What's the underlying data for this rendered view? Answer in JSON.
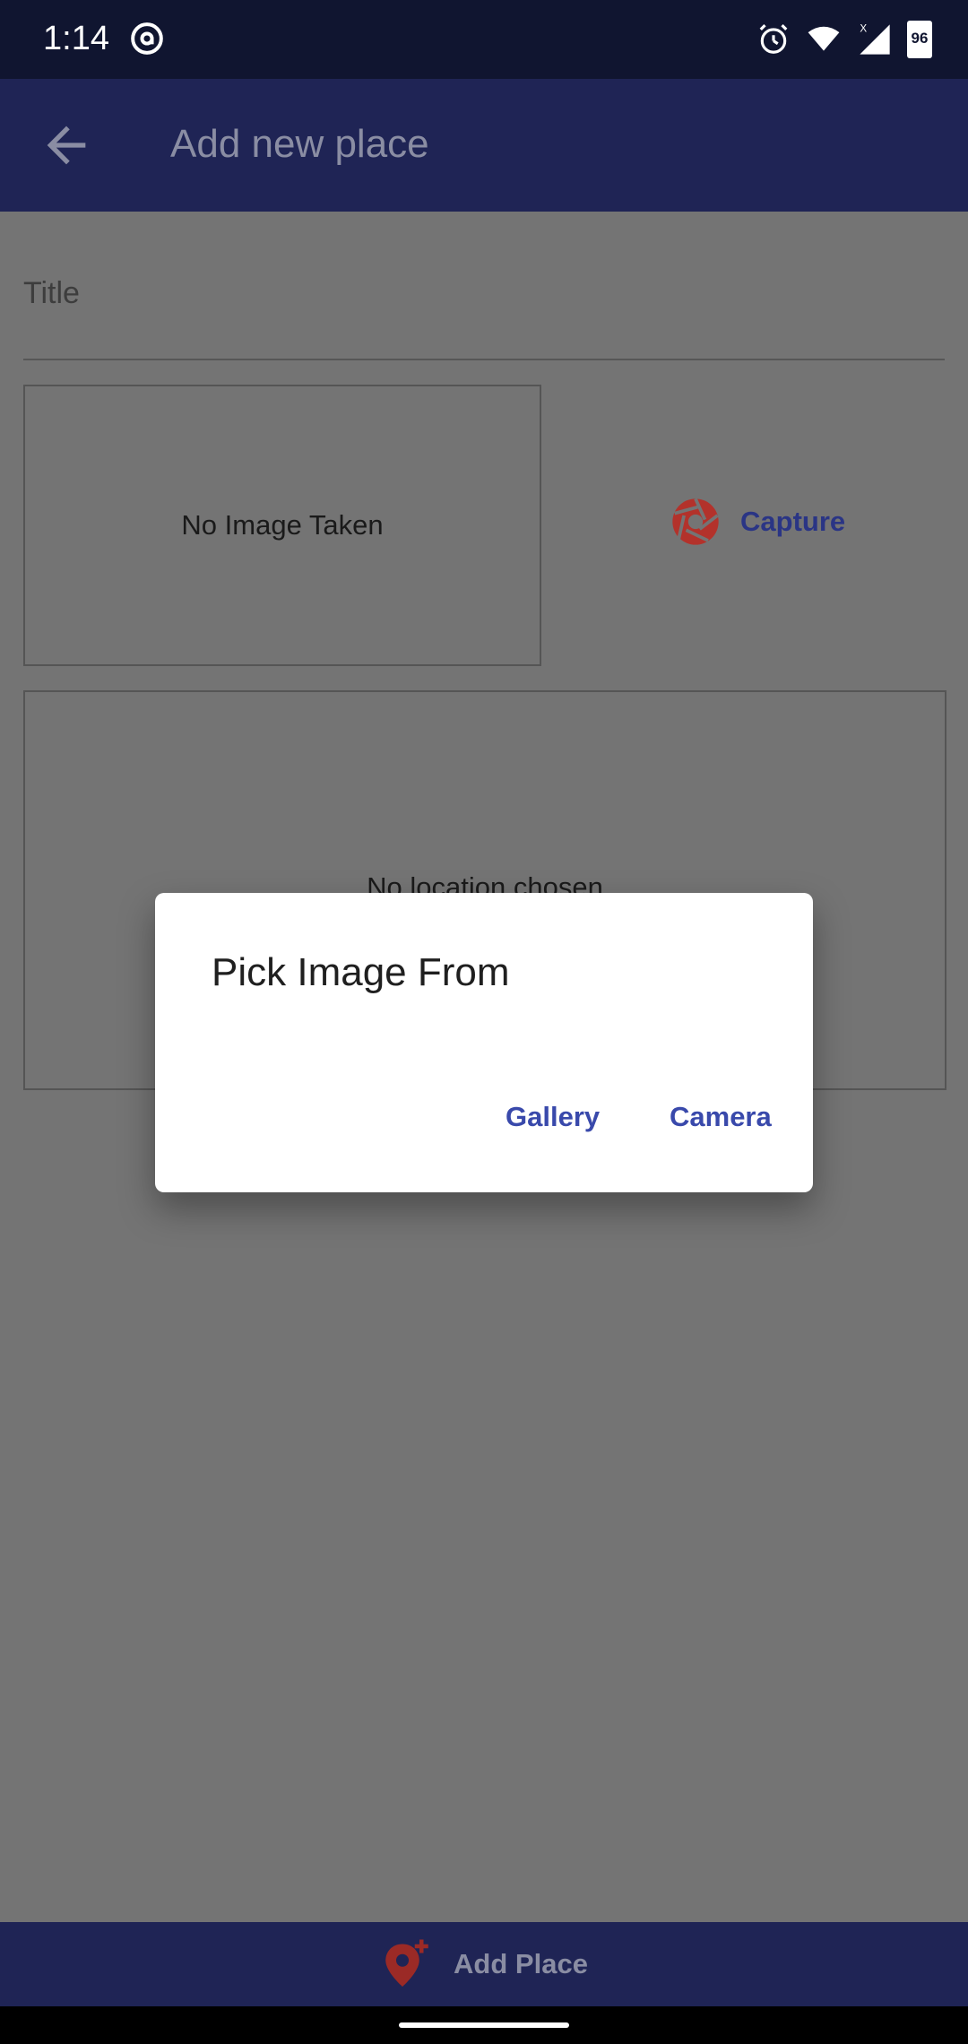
{
  "status": {
    "time": "1:14",
    "battery": "96",
    "icons": [
      "at-icon",
      "alarm-icon",
      "wifi-icon",
      "signal-icon",
      "battery-icon"
    ]
  },
  "appbar": {
    "title": "Add new place"
  },
  "form": {
    "title_label": "Title",
    "image_placeholder": "No Image Taken",
    "capture_label": "Capture",
    "location_placeholder": "No location chosen"
  },
  "dialog": {
    "title": "Pick Image From",
    "gallery_label": "Gallery",
    "camera_label": "Camera"
  },
  "bottom": {
    "add_place_label": "Add Place"
  },
  "colors": {
    "appbar": "#1f2455",
    "scrim": "#747474",
    "accent": "#3949ab",
    "capture_icon": "#b3322b"
  }
}
